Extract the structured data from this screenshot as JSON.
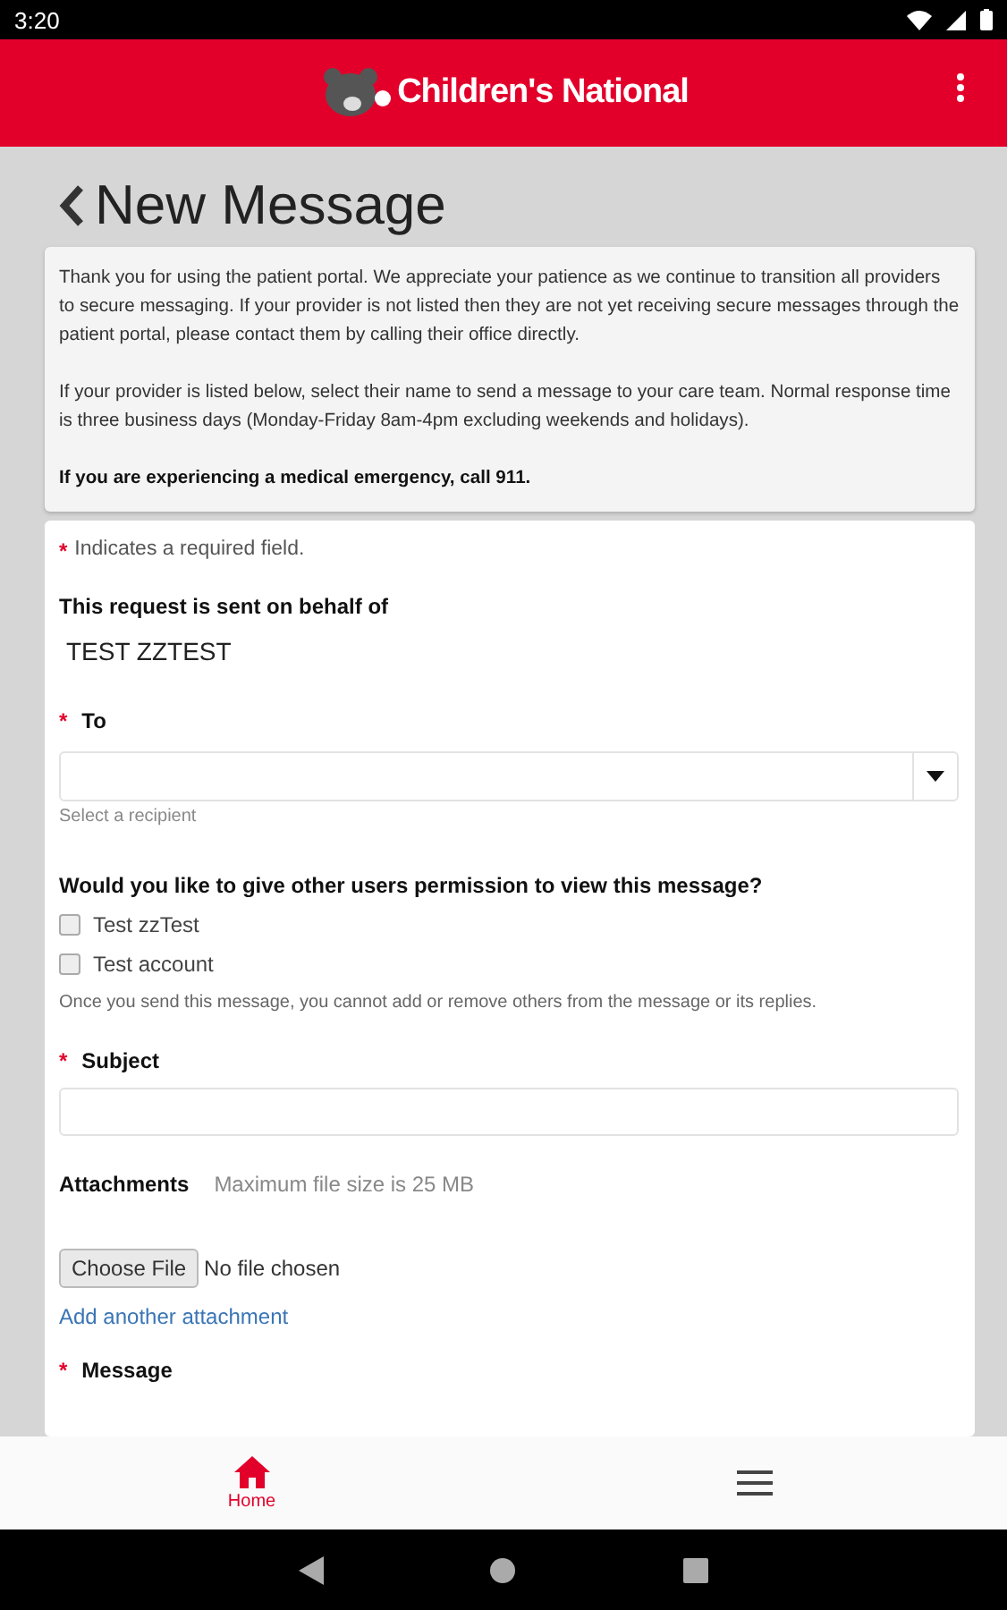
{
  "status_bar": {
    "time": "3:20"
  },
  "header": {
    "brand": "Children's National"
  },
  "page": {
    "title": "New Message"
  },
  "notice": {
    "paragraphs": [
      "Thank you for using the patient portal.  We appreciate your patience as we continue to transition all providers to secure messaging. If your provider is not listed then they are not yet receiving secure messages through the patient portal, please contact them by calling their office directly.",
      "If your provider is listed below, select their name to send a message to your care team. Normal response time is three business days (Monday-Friday 8am-4pm excluding weekends and holidays)."
    ],
    "emergency": "If you are experiencing a medical emergency, call 911."
  },
  "form": {
    "required_note": "Indicates a required field.",
    "required_mark": "*",
    "behalf_label": "This request is sent on behalf of",
    "behalf_name": "TEST ZZTEST",
    "to": {
      "label": "To",
      "required": true,
      "hint": "Select a recipient"
    },
    "permission": {
      "question": "Would you like to give other users permission to view this message?",
      "users": [
        {
          "name": "Test zzTest",
          "checked": false
        },
        {
          "name": "Test account",
          "checked": false
        }
      ],
      "note": "Once you send this message, you cannot add or remove others from the message or its replies."
    },
    "subject": {
      "label": "Subject",
      "required": true
    },
    "attachments": {
      "label": "Attachments",
      "limit": "Maximum file size is 25 MB",
      "button": "Choose File",
      "status": "No file chosen",
      "add_link": "Add another attachment"
    },
    "message": {
      "label": "Message",
      "required": true
    }
  },
  "bottom_nav": [
    {
      "kind": "home",
      "label": "Home",
      "selected": true
    },
    {
      "kind": "menu",
      "selected": false
    }
  ]
}
